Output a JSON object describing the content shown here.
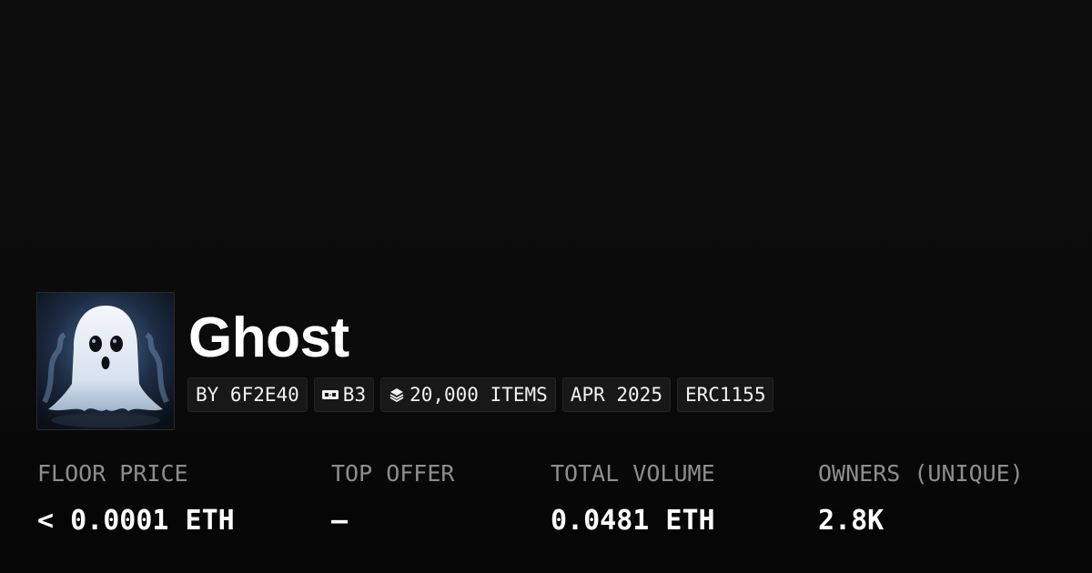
{
  "collection": {
    "name": "Ghost",
    "avatar_icon": "ghost-illustration"
  },
  "tags": [
    {
      "label": "BY 6F2E40",
      "icon": null
    },
    {
      "label": "B3",
      "icon": "chain-badge-icon"
    },
    {
      "label": "20,000 ITEMS",
      "icon": "layers-icon"
    },
    {
      "label": "APR 2025",
      "icon": null
    },
    {
      "label": "ERC1155",
      "icon": null
    }
  ],
  "stats": [
    {
      "label": "FLOOR PRICE",
      "value": "< 0.0001 ETH"
    },
    {
      "label": "TOP OFFER",
      "value": "—"
    },
    {
      "label": "TOTAL VOLUME",
      "value": "0.0481 ETH"
    },
    {
      "label": "OWNERS (UNIQUE)",
      "value": "2.8K"
    }
  ],
  "colors": {
    "background": "#0b0b0b",
    "tag_background": "#181818",
    "label": "#8e8e8e",
    "value": "#ffffff"
  }
}
